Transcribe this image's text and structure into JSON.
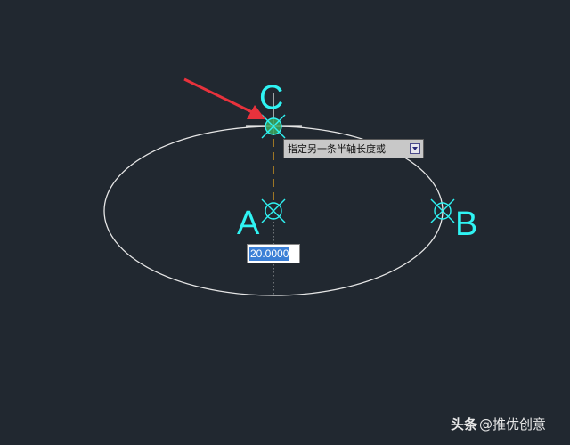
{
  "points": {
    "a": "A",
    "b": "B",
    "c": "C"
  },
  "tooltip": {
    "prompt": "指定另一条半轴长度或",
    "options_icon": "dropdown-arrow-icon"
  },
  "input": {
    "value": "20.0000"
  },
  "watermark": {
    "brand": "头条",
    "handle": "@推优创意"
  },
  "colors": {
    "background": "#212830",
    "ellipse": "#e6e6e6",
    "snap_marker": "#2ff3f3",
    "label": "#2ff3f3",
    "guide_line": "#e0a020",
    "arrow": "#e8323c"
  }
}
